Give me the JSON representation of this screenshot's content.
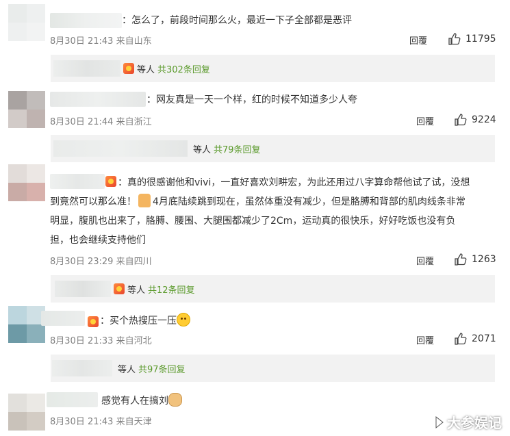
{
  "comments": [
    {
      "text": "：怎么了，前段时间那么火，最近一下子全部都是恶评",
      "time": "8月30日 21:43",
      "location": "来自山东",
      "reply_label": "回覆",
      "likes": "11795",
      "reply_who": "等人",
      "reply_count": "共302条回复"
    },
    {
      "text": "：网友真是一天一个样，红的时候不知道多少人夸",
      "time": "8月30日 21:44",
      "location": "来自浙江",
      "reply_label": "回覆",
      "likes": "9224",
      "reply_who": "等人",
      "reply_count": "共79条回复"
    },
    {
      "text_a": "：真的很感谢他和vivi，一直好喜欢刘畊宏，为此还用过八字算命帮他试了试，没想",
      "text_b": "到竟然可以那么准！",
      "text_c": "4月底陆续跳到现在，虽然体重没有减少，但是胳膊和背部的肌肉线条非常",
      "text_d": "明显，腹肌也出来了，胳膊、腰围、大腿围都减少了2Cm，运动真的很快乐，好好吃饭也没有负",
      "text_e": "担，也会继续支持他们",
      "time": "8月30日 23:29",
      "location": "来自四川",
      "reply_label": "回覆",
      "likes": "1263",
      "reply_who": "等人",
      "reply_count": "共12条回复"
    },
    {
      "text": "：买个热搜压一压",
      "time": "8月30日 21:33",
      "location": "来自河北",
      "reply_label": "回覆",
      "likes": "2071",
      "reply_who": "等人",
      "reply_count": "共97条回复"
    },
    {
      "text": "感觉有人在搞刘",
      "time": "8月30日 21:43",
      "location": "来自天津"
    }
  ],
  "watermark": "大参娱记",
  "colors": {
    "reply_count": "#5b9a2c",
    "meta": "#808080",
    "reply_bg": "#f2f2f2"
  }
}
